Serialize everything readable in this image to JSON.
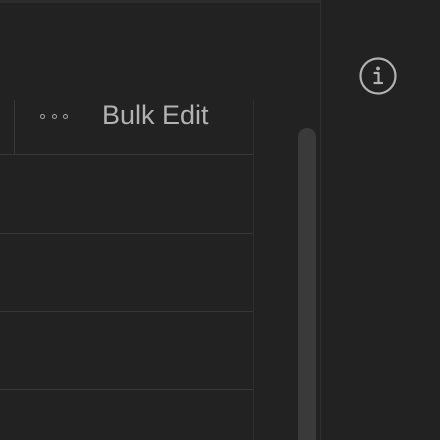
{
  "toolbar": {
    "more_icon": "more-horizontal-icon",
    "bulk_edit_label": "Bulk Edit"
  },
  "side_panel": {
    "info_icon": "info-icon"
  },
  "colors": {
    "background": "#222222",
    "divider": "#373737",
    "text": "#b2b2b2",
    "scrollbar_thumb": "#3a3a3a"
  }
}
